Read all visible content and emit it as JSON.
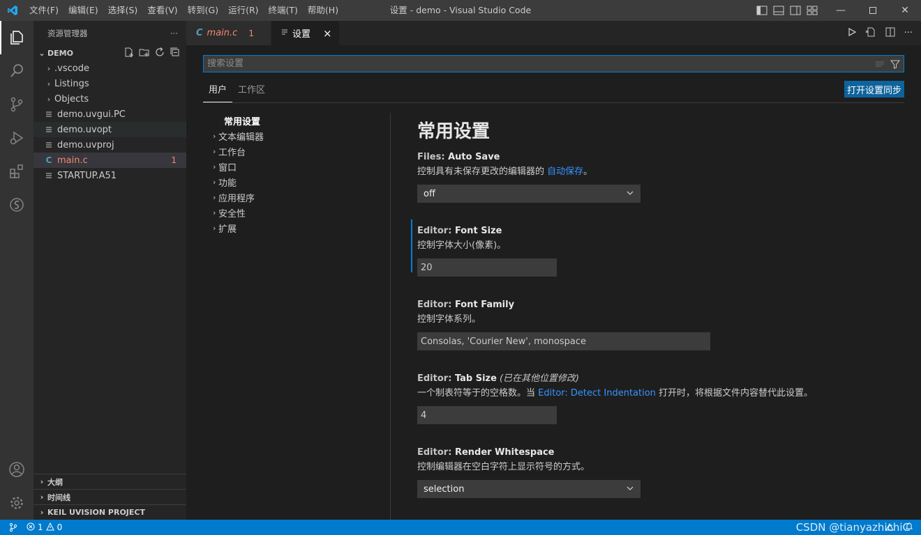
{
  "window": {
    "title": "设置 - demo - Visual Studio Code",
    "menu": [
      "文件(F)",
      "编辑(E)",
      "选择(S)",
      "查看(V)",
      "转到(G)",
      "运行(R)",
      "终端(T)",
      "帮助(H)"
    ]
  },
  "explorer": {
    "header": "资源管理器",
    "more": "···",
    "folder": "DEMO",
    "items": [
      {
        "label": ".vscode",
        "type": "folder"
      },
      {
        "label": "Listings",
        "type": "folder"
      },
      {
        "label": "Objects",
        "type": "folder"
      },
      {
        "label": "demo.uvgui.PC",
        "type": "file"
      },
      {
        "label": "demo.uvopt",
        "type": "file"
      },
      {
        "label": "demo.uvproj",
        "type": "file"
      },
      {
        "label": "main.c",
        "type": "c-file",
        "badge": "1"
      },
      {
        "label": "STARTUP.A51",
        "type": "file"
      }
    ],
    "sections": [
      "大纲",
      "时间线",
      "KEIL UVISION PROJECT"
    ]
  },
  "tabs": [
    {
      "label": "main.c",
      "icon": "C",
      "errors": "1"
    },
    {
      "label": "设置",
      "close": "×"
    }
  ],
  "settings": {
    "search_placeholder": "搜索设置",
    "scopes": [
      "用户",
      "工作区"
    ],
    "sync_button": "打开设置同步",
    "toc": [
      "常用设置",
      "文本编辑器",
      "工作台",
      "窗口",
      "功能",
      "应用程序",
      "安全性",
      "扩展"
    ],
    "section_title": "常用设置",
    "items": [
      {
        "category": "Files: ",
        "key": "Auto Save",
        "desc_prefix": "控制具有未保存更改的编辑器的 ",
        "desc_link": "自动保存",
        "desc_suffix": "。",
        "value": "off"
      },
      {
        "category": "Editor: ",
        "key": "Font Size",
        "desc": "控制字体大小(像素)。",
        "value": "20"
      },
      {
        "category": "Editor: ",
        "key": "Font Family",
        "desc": "控制字体系列。",
        "value": "Consolas, 'Courier New', monospace"
      },
      {
        "category": "Editor: ",
        "key": "Tab Size",
        "modified": "(已在其他位置修改)",
        "desc_prefix": "一个制表符等于的空格数。当 ",
        "desc_link": "Editor: Detect Indentation",
        "desc_suffix": " 打开时，将根据文件内容替代此设置。",
        "value": "4"
      },
      {
        "category": "Editor: ",
        "key": "Render Whitespace",
        "desc": "控制编辑器在空白字符上显示符号的方式。",
        "value": "selection"
      }
    ]
  },
  "statusbar": {
    "errors": "1",
    "warnings": "0",
    "watermark": "CSDN @tianyazhichiC"
  },
  "colors": {
    "accent": "#007acc",
    "link": "#3794ff",
    "error": "#f48771"
  }
}
